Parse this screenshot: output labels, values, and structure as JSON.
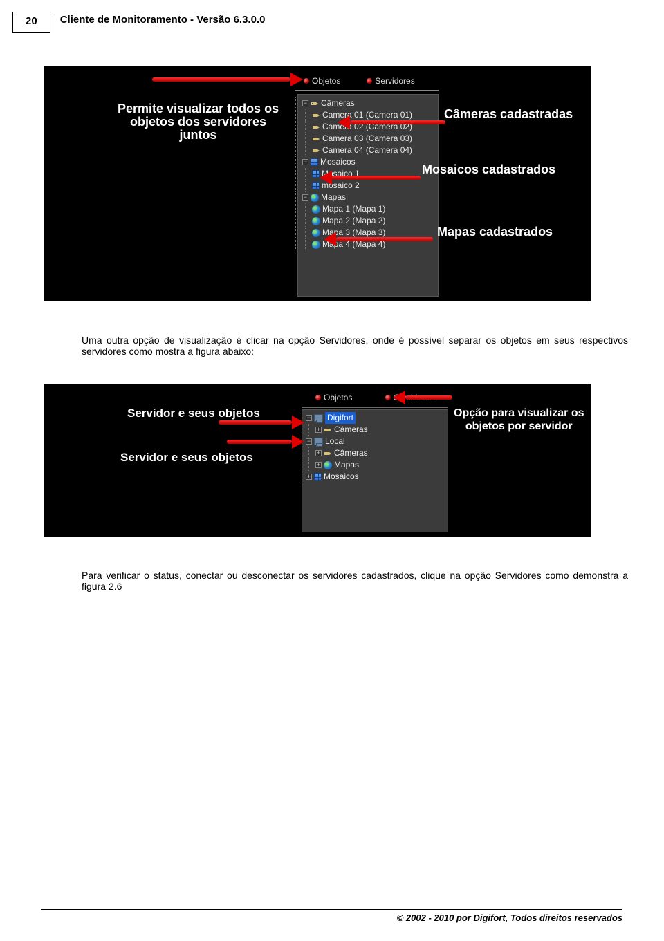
{
  "page_number": "20",
  "header_title": "Cliente de Monitoramento - Versão 6.3.0.0",
  "shot1": {
    "tabs": {
      "objetos": "Objetos",
      "servidores": "Servidores"
    },
    "tree": {
      "cameras_root": "Câmeras",
      "cameras": [
        "Camera 01 (Camera 01)",
        "Camera 02 (Camera 02)",
        "Camera 03 (Camera 03)",
        "Camera 04 (Camera 04)"
      ],
      "mosaicos_root": "Mosaicos",
      "mosaicos": [
        "Mosaico 1",
        "mosaico 2"
      ],
      "mapas_root": "Mapas",
      "mapas": [
        "Mapa 1 (Mapa 1)",
        "Mapa 2 (Mapa 2)",
        "Mapa 3 (Mapa 3)",
        "Mapa 4 (Mapa 4)"
      ]
    },
    "callouts": {
      "left": "Permite visualizar todos os\nobjetos dos servidores\njuntos",
      "right1": "Câmeras cadastradas",
      "right2": "Mosaicos cadastrados",
      "right3": "Mapas cadastrados"
    }
  },
  "paragraph1": "Uma outra opção de visualização é clicar na opção Servidores, onde é possível separar os objetos em seus respectivos servidores como mostra a figura abaixo:",
  "shot2": {
    "tabs": {
      "objetos": "Objetos",
      "servidores": "Servidores"
    },
    "tree": {
      "srv1": "Digifort",
      "srv1_child": "Câmeras",
      "srv2": "Local",
      "srv2_children": [
        "Câmeras",
        "Mapas"
      ],
      "mosaicos": "Mosaicos"
    },
    "callouts": {
      "left1": "Servidor e seus objetos",
      "left2": "Servidor e seus objetos",
      "right": "Opção para visualizar os\nobjetos por servidor"
    }
  },
  "paragraph2": "Para  verificar o status, conectar ou desconectar os servidores cadastrados, clique na opção Servidores como demonstra a figura 2.6",
  "footer": "© 2002 - 2010  por Digifort, Todos direitos reservados"
}
